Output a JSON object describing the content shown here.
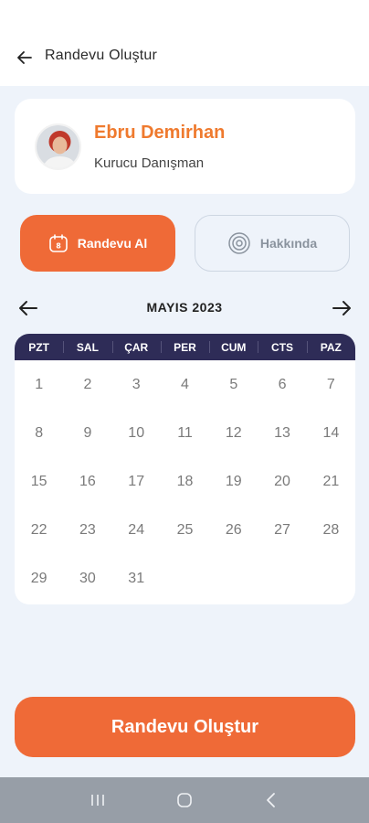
{
  "header": {
    "title": "Randevu Oluştur"
  },
  "profile": {
    "name": "Ebru Demirhan",
    "role": "Kurucu Danışman"
  },
  "tabs": [
    {
      "label": "Randevu Al",
      "icon": "calendar-icon",
      "active": true
    },
    {
      "label": "Hakkında",
      "icon": "info-icon",
      "active": false
    }
  ],
  "calendar": {
    "month_label": "MAYIS 2023",
    "weekdays": [
      "PZT",
      "SAL",
      "ÇAR",
      "PER",
      "CUM",
      "CTS",
      "PAZ"
    ],
    "days": [
      "1",
      "2",
      "3",
      "4",
      "5",
      "6",
      "7",
      "8",
      "9",
      "10",
      "11",
      "12",
      "13",
      "14",
      "15",
      "16",
      "17",
      "18",
      "19",
      "20",
      "21",
      "22",
      "23",
      "24",
      "25",
      "26",
      "27",
      "28",
      "29",
      "30",
      "31"
    ]
  },
  "primary_button": {
    "label": "Randevu Oluştur"
  },
  "colors": {
    "accent": "#ef6a37",
    "name_color": "#ef7a2e",
    "header_dark": "#2e2c57",
    "background": "#eef3fa"
  }
}
